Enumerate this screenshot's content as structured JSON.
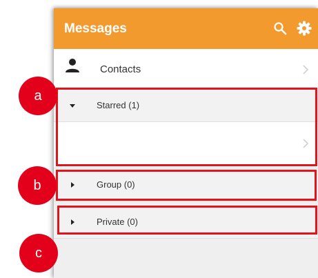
{
  "header": {
    "title": "Messages",
    "icons": [
      "search-icon",
      "gear-icon"
    ],
    "color": "#f39a2f"
  },
  "contacts": {
    "label": "Contacts",
    "icon": "person-icon"
  },
  "sections": {
    "starred": {
      "label": "Starred (1)",
      "expanded": true
    },
    "group": {
      "label": "Group (0)",
      "expanded": false
    },
    "private": {
      "label": "Private (0)",
      "expanded": false
    }
  },
  "callouts": {
    "a": "a",
    "b": "b",
    "c": "c",
    "color": "#e2001a"
  }
}
